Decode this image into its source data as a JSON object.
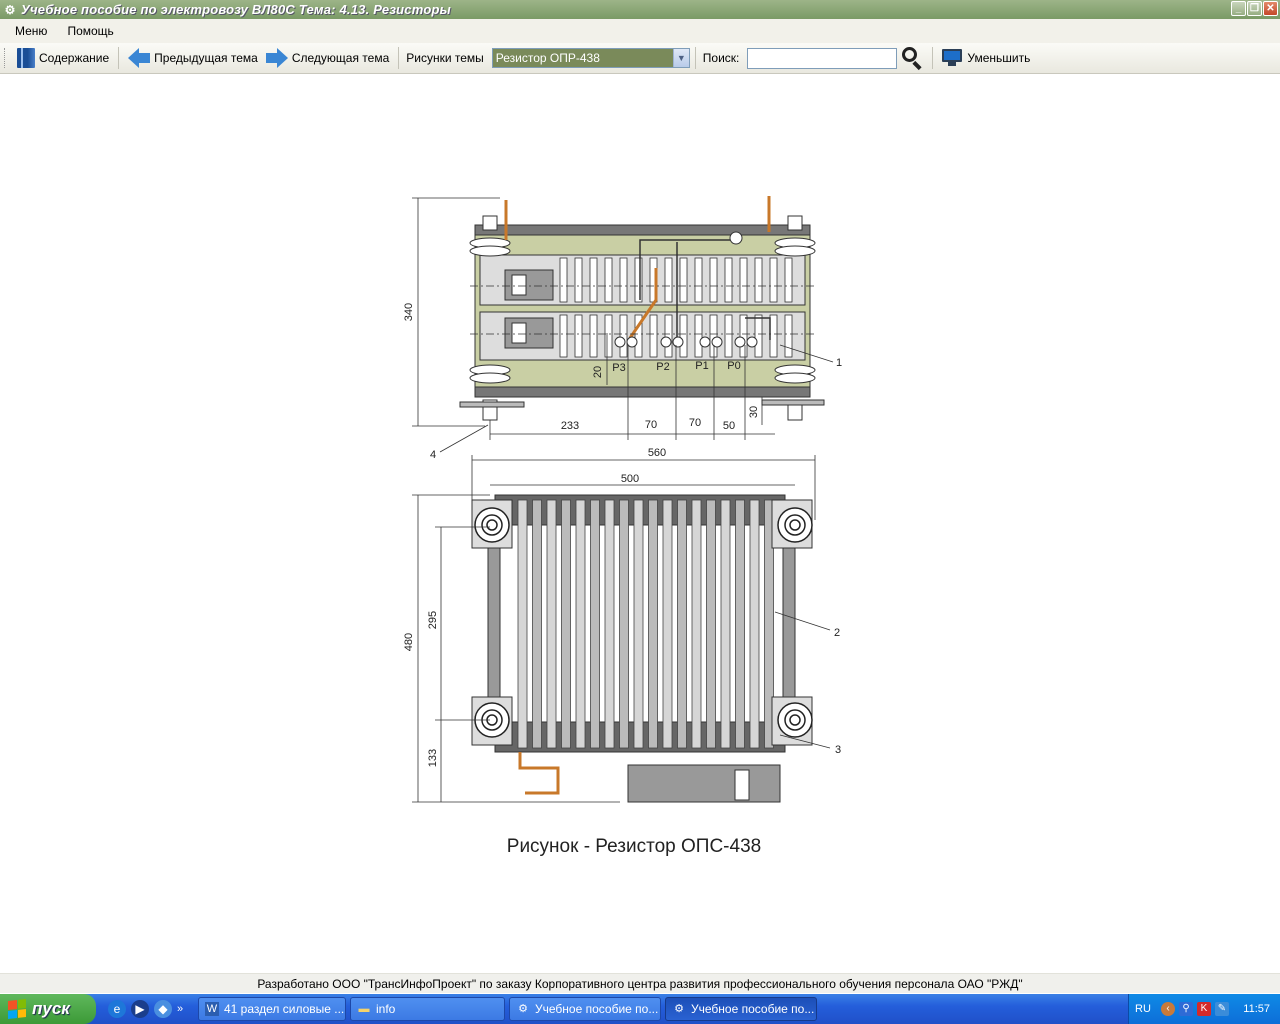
{
  "window": {
    "title": "Учебное пособие по электровозу ВЛ80С Тема: 4.13. Резисторы",
    "icon": "gear-icon",
    "buttons": [
      "minimize-icon",
      "restore-icon",
      "close-icon"
    ]
  },
  "menu": {
    "items": [
      {
        "label": "Меню"
      },
      {
        "label": "Помощь"
      }
    ]
  },
  "toolbar": {
    "contents_label": "Содержание",
    "prev_label": "Предыдущая тема",
    "next_label": "Следующая тема",
    "figures_label": "Рисунки темы",
    "figures_selected": "Резистор ОПР-438",
    "search_label": "Поиск:",
    "search_value": "",
    "shrink_label": "Уменьшить",
    "colors": {
      "arrow": "#3a86d4",
      "select_bg": "#7a8a5a"
    }
  },
  "figure": {
    "caption": "Рисунок - Резистор ОПС-438",
    "top_view": {
      "dims": {
        "height": "340",
        "d20": "20",
        "d233": "233",
        "d70a": "70",
        "d70b": "70",
        "d50": "50",
        "d30": "30",
        "d560": "560"
      },
      "terminals": [
        "Р3",
        "Р2",
        "Р1",
        "Р0"
      ],
      "callouts": {
        "c1": "1",
        "c4": "4"
      }
    },
    "front_view": {
      "dims": {
        "d500": "500",
        "d480": "480",
        "d295": "295",
        "d133": "133"
      },
      "callouts": {
        "c2": "2",
        "c3": "3"
      }
    },
    "colors": {
      "frame": "#c9cfa4",
      "plate": "#666666",
      "bar": "#c8782a"
    }
  },
  "footer": {
    "text": "Разработано ООО \"ТрансИнфоПроект\" по заказу Корпоративного центра развития профессионального обучения персонала ОАО \"РЖД\""
  },
  "taskbar": {
    "start_label": "пуск",
    "tasks": [
      {
        "label": "41 раздел силовые ...",
        "icon": "word-icon"
      },
      {
        "label": "info",
        "icon": "folder-icon"
      },
      {
        "label": "Учебное пособие по...",
        "icon": "gear-icon"
      },
      {
        "label": "Учебное пособие по...",
        "icon": "gear-icon"
      }
    ],
    "lang": "RU",
    "clock": "11:57"
  }
}
